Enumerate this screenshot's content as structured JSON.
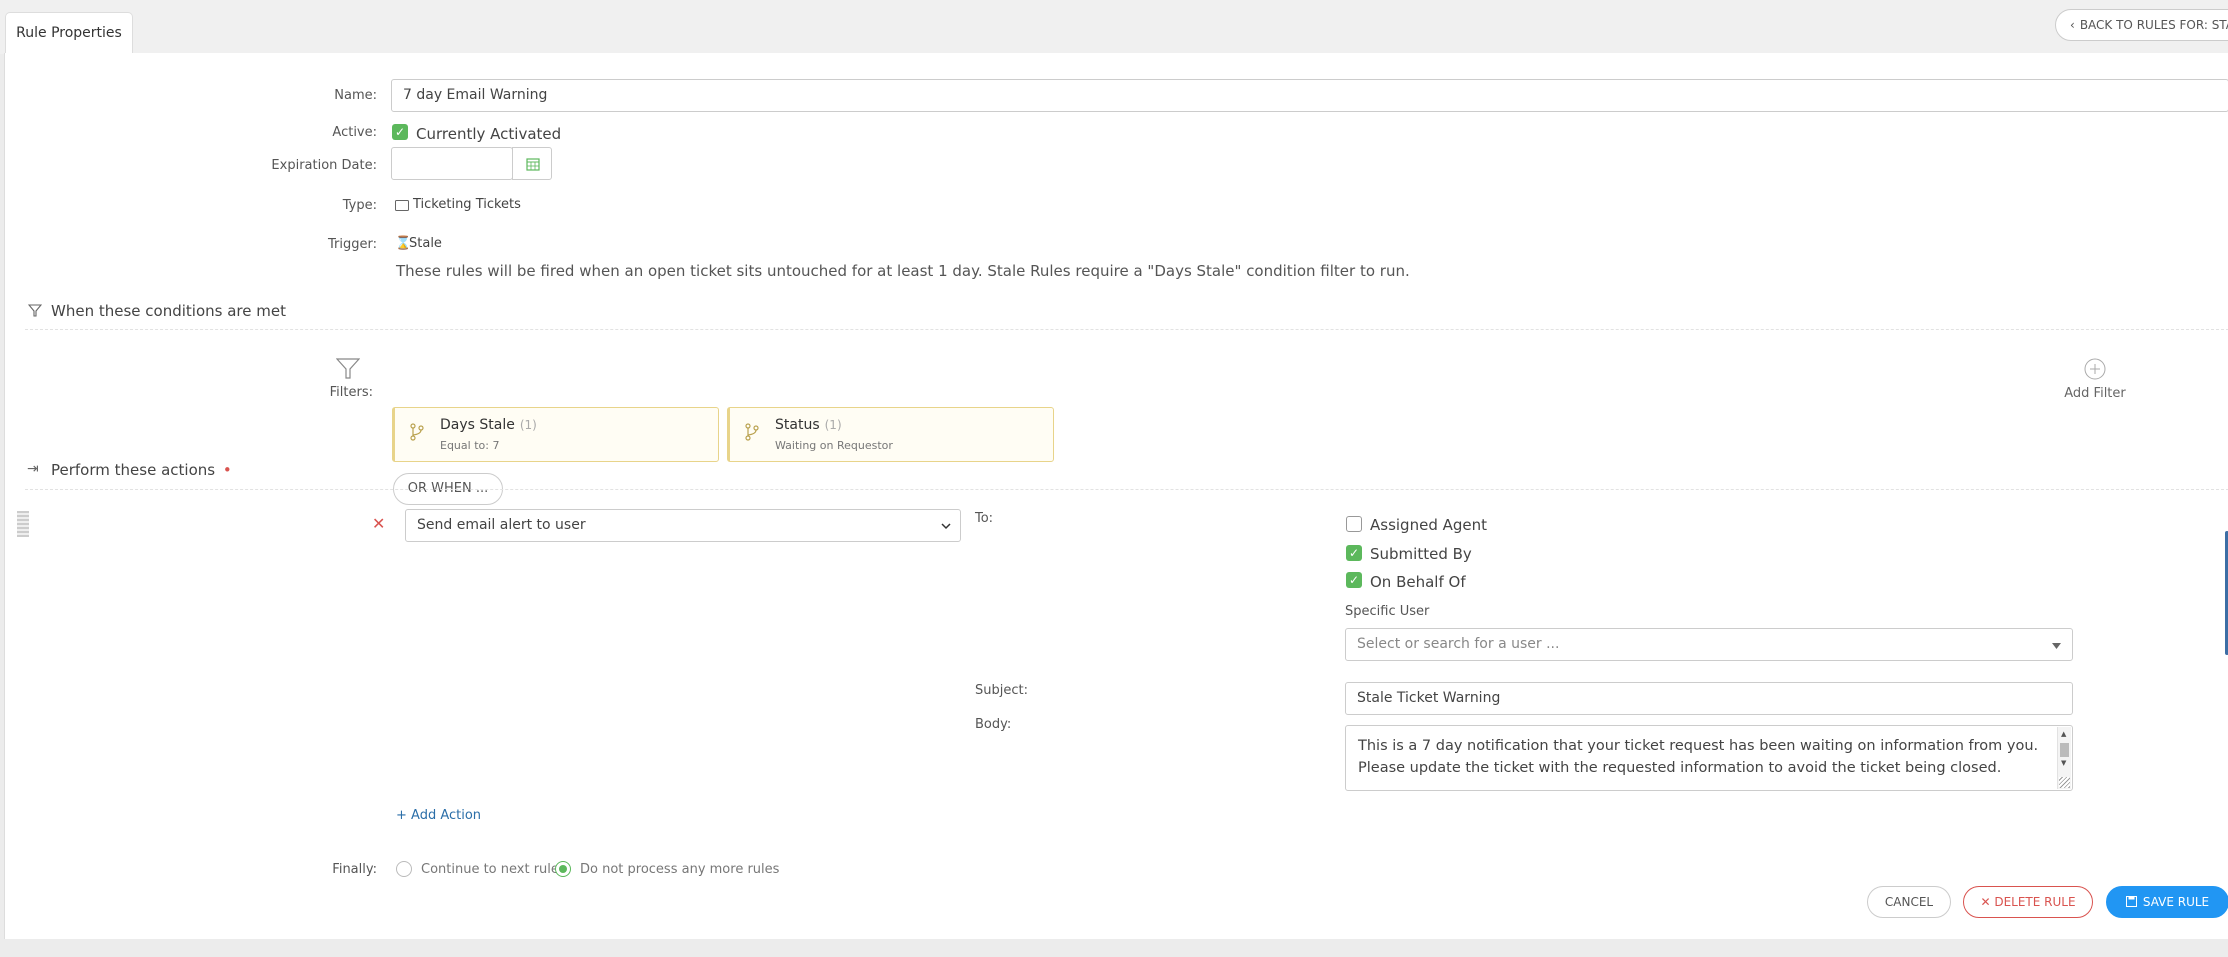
{
  "tabs": {
    "rule_properties": "Rule Properties"
  },
  "header": {
    "back_button": "BACK TO RULES FOR: STA"
  },
  "form": {
    "name_label": "Name:",
    "name_value": "7 day Email Warning",
    "active_label": "Active:",
    "active_value": "Currently Activated",
    "active_checked": true,
    "expiration_label": "Expiration Date:",
    "expiration_value": "",
    "type_label": "Type:",
    "type_value": "Ticketing Tickets",
    "trigger_label": "Trigger:",
    "trigger_value": "Stale",
    "trigger_description": "These rules will be fired when an open ticket sits untouched for at least 1 day. Stale Rules require a \"Days Stale\" condition filter to run."
  },
  "conditions": {
    "section_title": "When these conditions are met",
    "filters_label": "Filters:",
    "filters": [
      {
        "name": "Days Stale",
        "count": "(1)",
        "detail": "Equal to: 7"
      },
      {
        "name": "Status",
        "count": "(1)",
        "detail": "Waiting on Requestor"
      }
    ],
    "or_when_button": "OR WHEN ...",
    "add_filter_label": "Add Filter"
  },
  "actions": {
    "section_title": "Perform these actions",
    "required_marker": "•",
    "action_select_value": "Send email alert to user",
    "to_label": "To:",
    "recipients": [
      {
        "label": "Assigned Agent",
        "checked": false
      },
      {
        "label": "Submitted By",
        "checked": true
      },
      {
        "label": "On Behalf Of",
        "checked": true
      }
    ],
    "specific_user_label": "Specific User",
    "specific_user_placeholder": "Select or search for a user ...",
    "subject_label": "Subject:",
    "subject_value": "Stale Ticket Warning",
    "body_label": "Body:",
    "body_value": "This is a 7 day notification that your ticket request has been waiting on information from you. Please update the ticket with the requested information to avoid the ticket being closed.",
    "add_action_label": "+ Add Action"
  },
  "finally": {
    "label": "Finally:",
    "options": [
      {
        "label": "Continue to next rule",
        "selected": false
      },
      {
        "label": "Do not process any more rules",
        "selected": true
      }
    ]
  },
  "footer": {
    "cancel": "CANCEL",
    "delete": "DELETE RULE",
    "save": "SAVE RULE"
  },
  "colors": {
    "accent_blue": "#2196f3",
    "check_green": "#5cb85c",
    "danger_red": "#d9534f",
    "filter_border": "#e8d48a"
  }
}
